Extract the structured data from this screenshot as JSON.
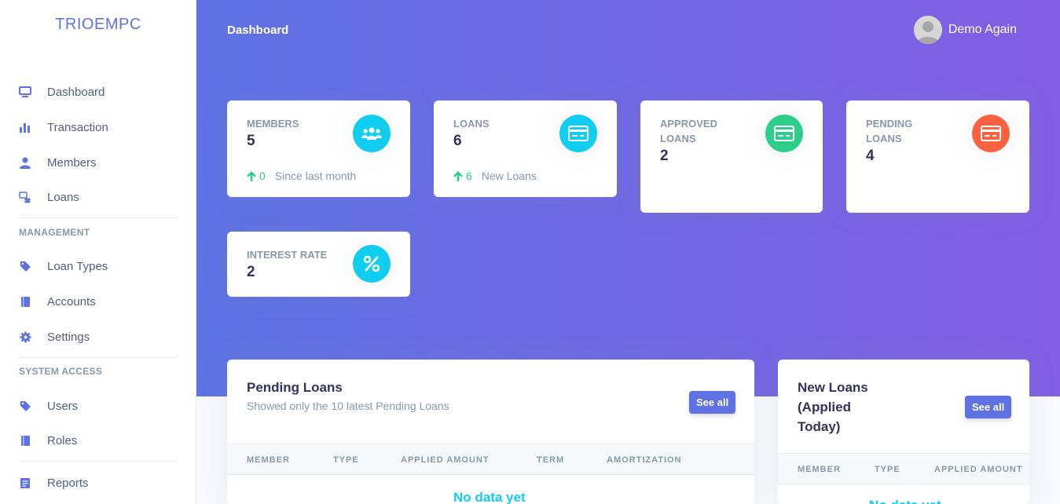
{
  "brand": "TRIOEMPC",
  "sidebar": {
    "items": [
      {
        "label": "Dashboard",
        "icon": "monitor-icon"
      },
      {
        "label": "Transaction",
        "icon": "bar-chart-icon"
      },
      {
        "label": "Members",
        "icon": "user-icon"
      },
      {
        "label": "Loans",
        "icon": "coins-icon"
      }
    ],
    "management_heading": "MANAGEMENT",
    "management": [
      {
        "label": "Loan Types",
        "icon": "tag-icon"
      },
      {
        "label": "Accounts",
        "icon": "book-icon"
      },
      {
        "label": "Settings",
        "icon": "gear-icon"
      }
    ],
    "system_heading": "SYSTEM ACCESS",
    "system": [
      {
        "label": "Users",
        "icon": "tag-icon"
      },
      {
        "label": "Roles",
        "icon": "book-icon"
      }
    ],
    "reports": {
      "label": "Reports",
      "icon": "report-icon"
    }
  },
  "header": {
    "title": "Dashboard",
    "user_name": "Demo Again"
  },
  "stats": {
    "members": {
      "label": "MEMBERS",
      "value": "5",
      "delta": "0",
      "foot": "Since last month",
      "color": "#11cdef"
    },
    "loans": {
      "label": "LOANS",
      "value": "6",
      "delta": "6",
      "foot": "New Loans",
      "color": "#11cdef"
    },
    "approved": {
      "label": "APPROVED LOANS",
      "value": "2",
      "color": "#2dce89"
    },
    "pending": {
      "label": "PENDING LOANS",
      "value": "4",
      "color": "#fb6340"
    },
    "interest": {
      "label": "INTEREST RATE",
      "value": "2",
      "color": "#11cdef"
    }
  },
  "pending_card": {
    "title": "Pending Loans",
    "subtitle": "Showed only the 10 latest Pending Loans",
    "button": "See all",
    "columns": [
      "MEMBER",
      "TYPE",
      "APPLIED AMOUNT",
      "TERM",
      "AMORTIZATION"
    ],
    "empty": "No data yet"
  },
  "new_card": {
    "title": "New Loans (Applied Today)",
    "button": "See all",
    "columns": [
      "MEMBER",
      "TYPE",
      "APPLIED AMOUNT"
    ],
    "empty": "No data yet"
  }
}
